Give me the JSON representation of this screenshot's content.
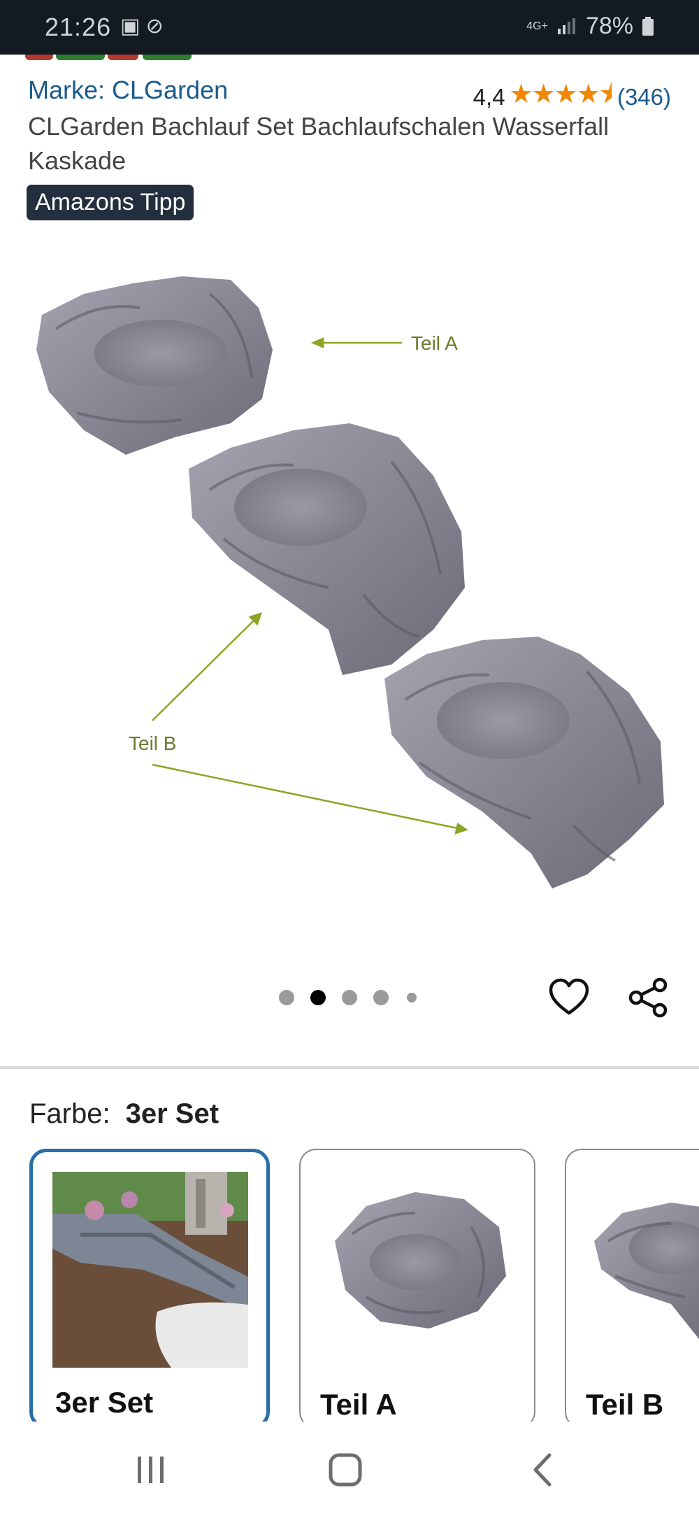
{
  "status_bar": {
    "time": "21:26",
    "left_icons": "▣ ⊘",
    "network": "4G+",
    "battery": "78%"
  },
  "brand": "Marke: CLGarden",
  "rating": {
    "value": "4,4",
    "stars": "★★★★⯨",
    "count": "(346)"
  },
  "title": "CLGarden Bachlauf Set Bachlaufschalen Wasserfall Kaskade",
  "badge": "Amazons Tipp",
  "image_labels": {
    "part_a": "Teil A",
    "part_b": "Teil B"
  },
  "carousel": {
    "count": 5,
    "active_index": 1
  },
  "variant": {
    "label": "Farbe:",
    "value": "3er Set"
  },
  "swatches": [
    {
      "label": "3er Set",
      "selected": true
    },
    {
      "label": "Teil A",
      "selected": false
    },
    {
      "label": "Teil B",
      "selected": false
    }
  ],
  "colors": {
    "accent_link": "#1a5a8c",
    "star": "#f08804",
    "badge_bg": "#232f3e",
    "selected_border": "#2a6ea9",
    "arrow": "#8aa623",
    "rock": "#8a8794"
  }
}
